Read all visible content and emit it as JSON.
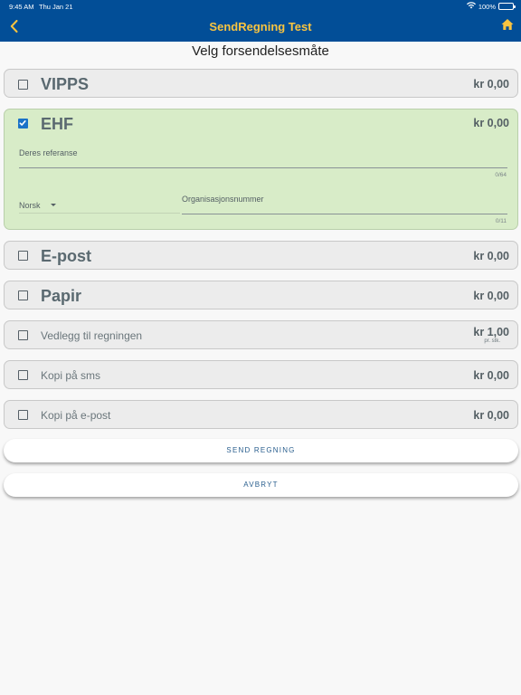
{
  "status_bar": {
    "time": "9:45 AM",
    "date": "Thu Jan 21",
    "battery": "100%",
    "battery_level": 1.0
  },
  "nav": {
    "title": "SendRegning Test",
    "back_icon": "chevron-left-icon",
    "home_icon": "home-icon"
  },
  "page_title": "Velg forsendelsesmåte",
  "options": [
    {
      "label": "VIPPS",
      "price": "kr 0,00",
      "checked": false
    },
    {
      "label": "EHF",
      "price": "kr 0,00",
      "checked": true
    },
    {
      "label": "E-post",
      "price": "kr 0,00",
      "checked": false
    },
    {
      "label": "Papir",
      "price": "kr 0,00",
      "checked": false
    },
    {
      "label": "Vedlegg til regningen",
      "price": "kr 1,00",
      "price_unit": "pr. stk.",
      "checked": false
    },
    {
      "label": "Kopi på sms",
      "price": "kr 0,00",
      "checked": false
    },
    {
      "label": "Kopi på e-post",
      "price": "kr 0,00",
      "checked": false
    }
  ],
  "ehf": {
    "reference_label": "Deres referanse",
    "reference_value": "",
    "reference_counter": "0/64",
    "language_value": "Norsk",
    "org_label": "Organisasjonsnummer",
    "org_value": "",
    "org_counter": "0/11"
  },
  "buttons": {
    "send": "SEND REGNING",
    "cancel": "AVBRYT"
  },
  "colors": {
    "nav_bg": "#024e97",
    "nav_title": "#f9c440",
    "selected_card": "#d8ecc8",
    "checkbox_checked": "#1a72c8",
    "card_bg": "#ececec"
  }
}
